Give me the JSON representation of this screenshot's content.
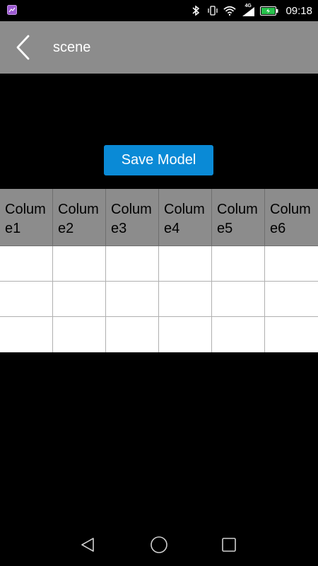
{
  "status_bar": {
    "time": "09:18",
    "network": "4G",
    "icons": [
      "gallery-icon",
      "bluetooth-icon",
      "vibrate-icon",
      "wifi-icon",
      "signal-icon",
      "battery-charging-icon"
    ],
    "battery_color": "#27c24c"
  },
  "app_bar": {
    "title": "scene",
    "back_icon": "chevron-left-icon",
    "background": "#8c8c8c"
  },
  "actions": {
    "save_label": "Save Model",
    "accent": "#0a8ad6"
  },
  "table": {
    "columns": [
      "Colume1",
      "Colume2",
      "Colume3",
      "Colume4",
      "Colume5",
      "Colume6"
    ],
    "rows": [
      [
        "",
        "",
        "",
        "",
        "",
        ""
      ],
      [
        "",
        "",
        "",
        "",
        "",
        ""
      ],
      [
        "",
        "",
        "",
        "",
        "",
        ""
      ]
    ]
  },
  "nav_bar": {
    "buttons": [
      "back-triangle-icon",
      "home-circle-icon",
      "recents-square-icon"
    ]
  }
}
